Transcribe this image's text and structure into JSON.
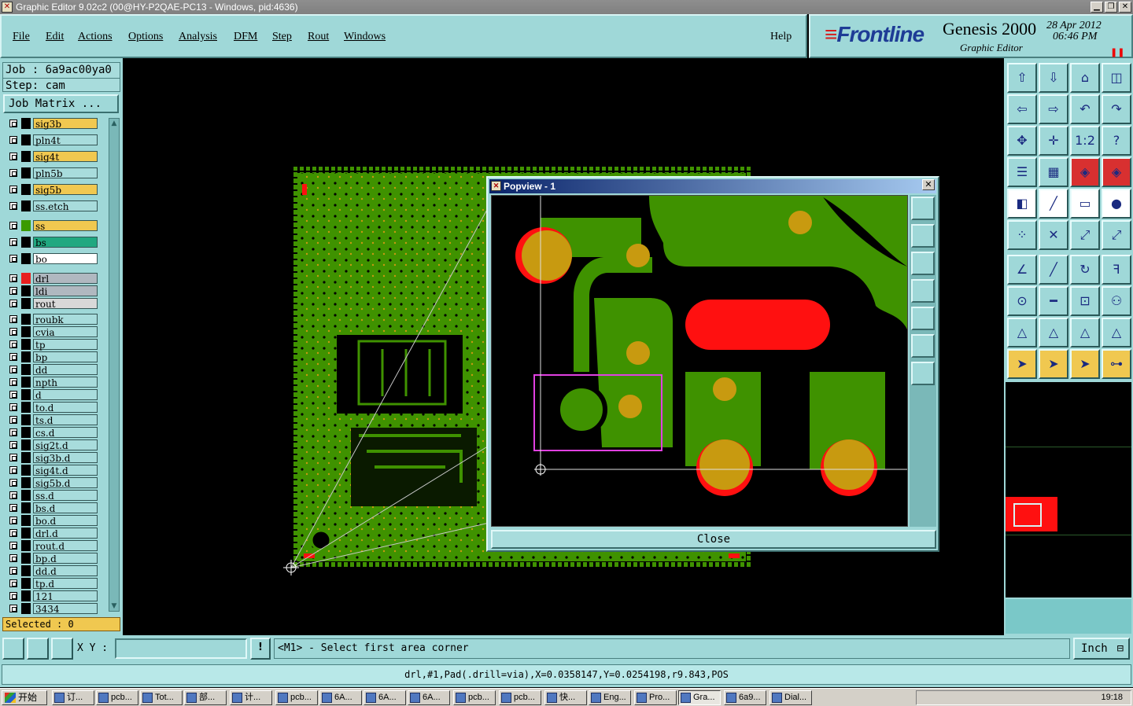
{
  "window": {
    "title": "Graphic Editor 9.02c2 (00@HY-P2QAE-PC13 - Windows, pid:4636)"
  },
  "menu": [
    "File",
    "Edit",
    "Actions",
    "Options",
    "Analysis",
    "DFM",
    "Step",
    "Rout",
    "Windows"
  ],
  "help": "Help",
  "brand": {
    "logo": "Frontline",
    "product": "Genesis 2000",
    "subtitle": "Graphic Editor",
    "date": "28 Apr 2012",
    "time": "06:46 PM"
  },
  "job": {
    "job": "Job : 6a9ac00ya0",
    "step": "Step: cam",
    "matrix_button": "Job Matrix ..."
  },
  "layers": [
    {
      "name": "sig3b",
      "sw": "#000",
      "bg": "#f0c850"
    },
    {
      "name": "pln4t",
      "sw": "#000",
      "bg": "#a8dcdc"
    },
    {
      "name": "sig4t",
      "sw": "#000",
      "bg": "#f0c850"
    },
    {
      "name": "pln5b",
      "sw": "#000",
      "bg": "#a8dcdc"
    },
    {
      "name": "sig5b",
      "sw": "#000",
      "bg": "#f0c850"
    },
    {
      "name": "ss.etch",
      "sw": "#000",
      "bg": "#a8dcdc"
    },
    {
      "name": "ss",
      "sw": "#3a9a00",
      "bg": "#f0c850"
    },
    {
      "name": "bs",
      "sw": "#000",
      "bg": "#20a880"
    },
    {
      "name": "bo",
      "sw": "#000",
      "bg": "#ffffff"
    },
    {
      "name": "drl",
      "sw": "#e82020",
      "bg": "#b0b8c0"
    },
    {
      "name": "ldi",
      "sw": "#000",
      "bg": "#b0b8c0"
    },
    {
      "name": "rout",
      "sw": "#000",
      "bg": "#d8d8d8"
    },
    {
      "name": "roubk",
      "sw": "#000",
      "bg": "#a8dcdc"
    },
    {
      "name": "cvia",
      "sw": "#000",
      "bg": "#a8dcdc"
    },
    {
      "name": "tp",
      "sw": "#000",
      "bg": "#a8dcdc"
    },
    {
      "name": "bp",
      "sw": "#000",
      "bg": "#a8dcdc"
    },
    {
      "name": "dd",
      "sw": "#000",
      "bg": "#a8dcdc"
    },
    {
      "name": "npth",
      "sw": "#000",
      "bg": "#a8dcdc"
    },
    {
      "name": "d",
      "sw": "#000",
      "bg": "#a8dcdc"
    },
    {
      "name": "to.d",
      "sw": "#000",
      "bg": "#a8dcdc"
    },
    {
      "name": "ts.d",
      "sw": "#000",
      "bg": "#a8dcdc"
    },
    {
      "name": "cs.d",
      "sw": "#000",
      "bg": "#a8dcdc"
    },
    {
      "name": "sig2t.d",
      "sw": "#000",
      "bg": "#a8dcdc"
    },
    {
      "name": "sig3b.d",
      "sw": "#000",
      "bg": "#a8dcdc"
    },
    {
      "name": "sig4t.d",
      "sw": "#000",
      "bg": "#a8dcdc"
    },
    {
      "name": "sig5b.d",
      "sw": "#000",
      "bg": "#a8dcdc"
    },
    {
      "name": "ss.d",
      "sw": "#000",
      "bg": "#a8dcdc"
    },
    {
      "name": "bs.d",
      "sw": "#000",
      "bg": "#a8dcdc"
    },
    {
      "name": "bo.d",
      "sw": "#000",
      "bg": "#a8dcdc"
    },
    {
      "name": "drl.d",
      "sw": "#000",
      "bg": "#a8dcdc"
    },
    {
      "name": "rout.d",
      "sw": "#000",
      "bg": "#a8dcdc"
    },
    {
      "name": "bp.d",
      "sw": "#000",
      "bg": "#a8dcdc"
    },
    {
      "name": "dd.d",
      "sw": "#000",
      "bg": "#a8dcdc"
    },
    {
      "name": "tp.d",
      "sw": "#000",
      "bg": "#a8dcdc"
    },
    {
      "name": "121",
      "sw": "#000",
      "bg": "#a8dcdc"
    },
    {
      "name": "3434",
      "sw": "#000",
      "bg": "#a8dcdc"
    }
  ],
  "selected": "Selected : 0",
  "popview": {
    "title": "Popview - 1",
    "close": "Close"
  },
  "status": {
    "xy_label": "X Y :",
    "xy_value": "",
    "prompt": "<M1> - Select first area corner",
    "unit": "Inch"
  },
  "info": "drl,#1,Pad(.drill=via),X=0.0358147,Y=0.0254198,r9.843,POS",
  "taskbar": {
    "start": "开始",
    "items": [
      "订...",
      "pcb...",
      "Tot...",
      "部...",
      "计...",
      "pcb...",
      "6A...",
      "6A...",
      "6A...",
      "pcb...",
      "pcb...",
      "快...",
      "Eng...",
      "Pro...",
      "Gra...",
      "6a9...",
      "Dial..."
    ],
    "clock": "19:18"
  },
  "colors": {
    "panel": "#9fd8d8",
    "copper": "#3f9200",
    "pad": "#c89a10",
    "drill": "#ff1010"
  }
}
